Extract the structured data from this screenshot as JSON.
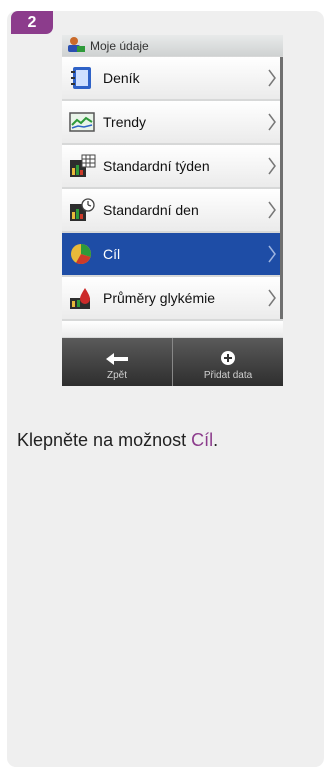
{
  "step": {
    "number": "2"
  },
  "screen": {
    "header_title": "Moje údaje",
    "items": [
      {
        "label": "Deník",
        "icon": "logbook-icon"
      },
      {
        "label": "Trendy",
        "icon": "trends-icon"
      },
      {
        "label": "Standardní týden",
        "icon": "standard-week-icon"
      },
      {
        "label": "Standardní den",
        "icon": "standard-day-icon"
      },
      {
        "label": "Cíl",
        "icon": "target-pie-icon",
        "selected": true
      },
      {
        "label": "Průměry glykémie",
        "icon": "averages-icon"
      }
    ],
    "footer": {
      "back_label": "Zpět",
      "add_label": "Přidat data"
    }
  },
  "instruction": {
    "prefix": "Klepněte na možnost ",
    "highlight": "Cíl",
    "suffix": "."
  },
  "colors": {
    "accent": "#8c3c8c",
    "selected_row": "#1e4da6"
  }
}
